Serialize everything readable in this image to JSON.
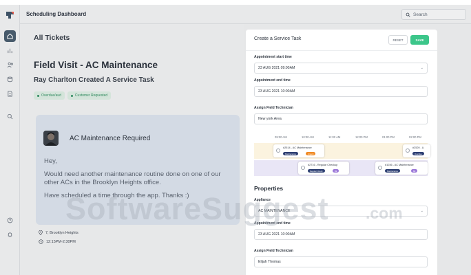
{
  "app": {
    "title": "Scheduling Dashboard"
  },
  "search": {
    "placeholder": "Search"
  },
  "main": {
    "section_title": "All Tickets",
    "ticket_title": "Field Visit - AC Maintenance",
    "ticket_subtitle": "Ray Charlton Created A Service Task",
    "tags": [
      "Overdue/aud",
      "Customer Requested"
    ]
  },
  "message": {
    "title": "AC Maintenance Required",
    "paragraphs": [
      "Hey,",
      "Would need another maintenance routine done on one of our other ACs in the Brooklyn Heights office.",
      "Have scheduled a time through the app. Thanks :)"
    ]
  },
  "meta": {
    "location": "7, Brooklyn Heights",
    "time": "12:15PM-2:30PM"
  },
  "panel": {
    "title": "Create a Service Task",
    "reset_label": "RESET",
    "save_label": "SAVE",
    "fields": {
      "start_label": "Appointment start time",
      "start_value": "23 AUG 2021 09:00AM",
      "end_label": "Appointment end time",
      "end_value": "23 AUG 2021 10:00AM",
      "tech_label": "Assign Field Technician",
      "tech_value": "New york Area"
    },
    "timeline": {
      "times": [
        "09:00 AM",
        "10:00 AM",
        "11:00 AM",
        "12:00 PM",
        "01:00 PM",
        "02:00 PM"
      ],
      "tasks": [
        {
          "name": "#2514 - AC Maintenance",
          "pills": [
            "Maintenance",
            "Urgent"
          ]
        },
        {
          "name": "#2520 - Li",
          "pills": [
            "Overdue"
          ]
        },
        {
          "name": "#2716 - Regular Checkup",
          "pills": [
            "Regular Check",
            "Bk"
          ]
        },
        {
          "name": "#1036 - AC Maintenance",
          "pills": [
            "Maintenance",
            "Bk"
          ]
        }
      ]
    },
    "properties_title": "Properties",
    "properties": {
      "appliance_label": "Appliance",
      "appliance_value": "AC MAINTENANCE",
      "end_label": "Appointment end time",
      "end_value": "23 AUG 2021 10:00AM",
      "tech_label": "Assign Field Technician",
      "tech_value": "Elijah Thomas"
    }
  },
  "watermark": {
    "main": "SoftwareSuggest",
    "suffix": ".com"
  },
  "colors": {
    "accent": "#3cc68a",
    "rail_active": "#475a6b",
    "card": "#d3dae4"
  }
}
